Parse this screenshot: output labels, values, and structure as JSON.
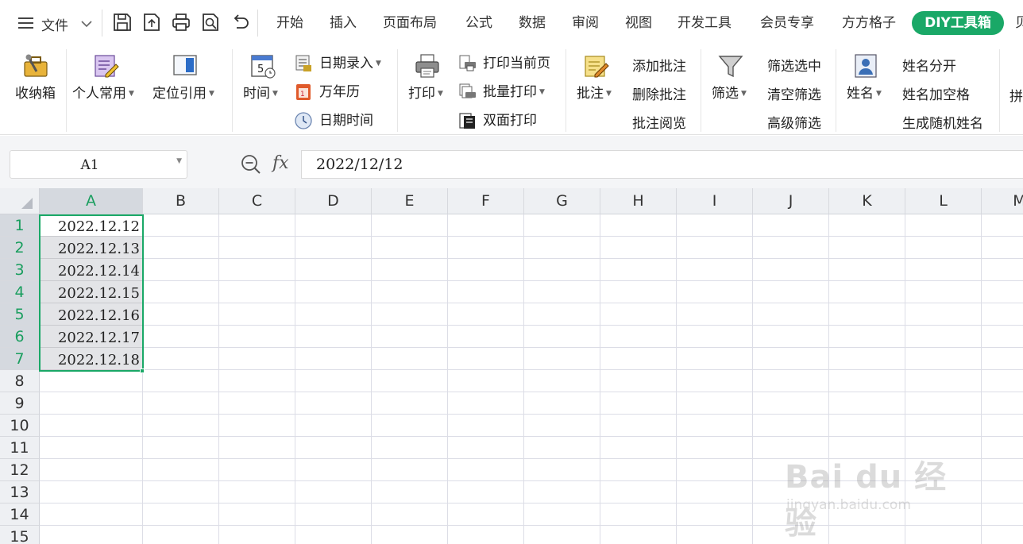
{
  "menubar": {
    "menu_label": "文件",
    "tabs": [
      "开始",
      "插入",
      "页面布局",
      "公式",
      "数据",
      "审阅",
      "视图",
      "开发工具",
      "会员专享",
      "方方格子"
    ],
    "active_tab": "DIY工具箱",
    "overflow_tab": "贝"
  },
  "ribbon": {
    "shoukana": "收纳箱",
    "geren": "个人常用",
    "dingwei": "定位引用",
    "shijian": "时间",
    "riqi_luru": "日期录入",
    "wannianli": "万年历",
    "riqi_shijian": "日期时间",
    "dayin": "打印",
    "dayin_dangqian": "打印当前页",
    "piliang_dayin": "批量打印",
    "shuangmian_dayin": "双面打印",
    "pizhu": "批注",
    "tianjia_pizhu": "添加批注",
    "shanchu_pizhu": "删除批注",
    "pizhu_yuelan": "批注阅览",
    "shaixuan": "筛选",
    "shaixuan_xuanzhong": "筛选选中",
    "qingkong_shaixuan": "清空筛选",
    "gaoji_shaixuan": "高级筛选",
    "xingming": "姓名",
    "xingming_fenkai": "姓名分开",
    "xingming_jiakongge": "姓名加空格",
    "shengcheng_suiji": "生成随机姓名",
    "pin": "拼"
  },
  "formula_bar": {
    "name_box": "A1",
    "fx": "fx",
    "value": "2022/12/12"
  },
  "sheet": {
    "columns": [
      "A",
      "B",
      "C",
      "D",
      "E",
      "F",
      "G",
      "H",
      "I",
      "J",
      "K",
      "L",
      "M"
    ],
    "rows": [
      "1",
      "2",
      "3",
      "4",
      "5",
      "6",
      "7",
      "8",
      "9",
      "10",
      "11",
      "12",
      "13",
      "14",
      "15"
    ],
    "cells_a": [
      "2022.12.12",
      "2022.12.13",
      "2022.12.14",
      "2022.12.15",
      "2022.12.16",
      "2022.12.17",
      "2022.12.18"
    ]
  },
  "watermark": {
    "logo": "Bai du 经验",
    "url": "jingyan.baidu.com"
  },
  "colors": {
    "accent": "#1aa867",
    "selection_fill": "#e3e4e7",
    "header_bg": "#eef0f3"
  }
}
